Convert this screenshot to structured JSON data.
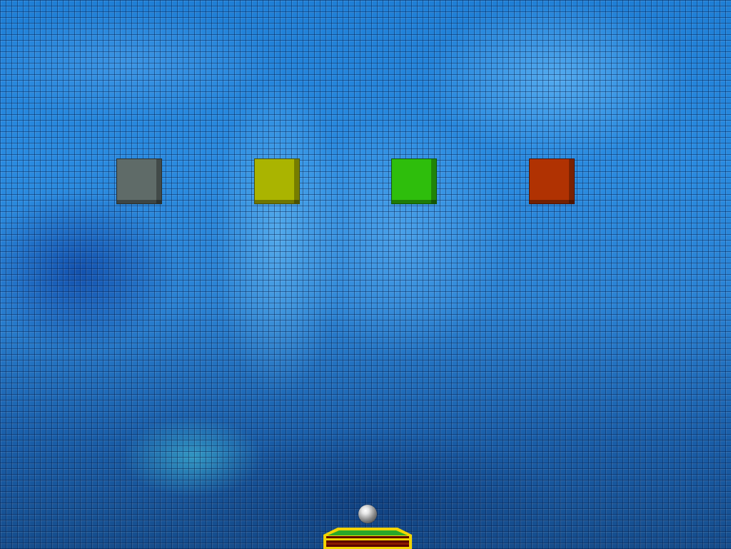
{
  "game": {
    "bricks": [
      {
        "name": "brick-gray",
        "color": "#5f6b68"
      },
      {
        "name": "brick-yellow",
        "color": "#aab400"
      },
      {
        "name": "brick-green",
        "color": "#2ebe0c"
      },
      {
        "name": "brick-red",
        "color": "#b03202"
      }
    ],
    "ball": {
      "icon": "metal-ball-icon"
    },
    "paddle": {
      "colors": {
        "outline": "#f2d400",
        "top": "#29a829",
        "stripe": "#7a0000"
      }
    }
  }
}
